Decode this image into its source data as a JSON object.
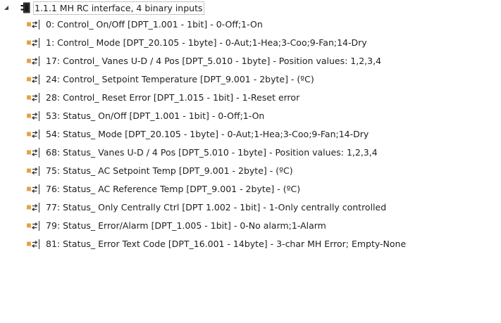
{
  "tree": {
    "device": {
      "label": "1.1.1  MH RC interface, 4 binary inputs",
      "expanded": true,
      "expander_icon": "triangle-down-icon",
      "icon": "knx-device-icon"
    },
    "object_icon": "group-object-arrows-icon",
    "objects": [
      {
        "label": "0: Control_ On/Off [DPT_1.001 - 1bit] - 0-Off;1-On"
      },
      {
        "label": "1: Control_ Mode [DPT_20.105 - 1byte] - 0-Aut;1-Hea;3-Coo;9-Fan;14-Dry"
      },
      {
        "label": "17: Control_ Vanes U-D / 4 Pos [DPT_5.010 - 1byte] - Position values: 1,2,3,4"
      },
      {
        "label": "24: Control_ Setpoint Temperature [DPT_9.001 - 2byte] - (ºC)"
      },
      {
        "label": "28: Control_ Reset Error [DPT_1.015 - 1bit] - 1-Reset error"
      },
      {
        "label": "53: Status_ On/Off [DPT_1.001 - 1bit] - 0-Off;1-On"
      },
      {
        "label": "54: Status_ Mode [DPT_20.105 - 1byte] - 0-Aut;1-Hea;3-Coo;9-Fan;14-Dry"
      },
      {
        "label": "68: Status_ Vanes U-D / 4 Pos [DPT_5.010 - 1byte] - Position values: 1,2,3,4"
      },
      {
        "label": "75: Status_ AC Setpoint Temp [DPT_9.001 - 2byte] - (ºC)"
      },
      {
        "label": "76: Status_ AC Reference Temp [DPT_9.001 - 2byte] - (ºC)"
      },
      {
        "label": "77: Status_ Only Centrally Ctrl [DPT 1.002 - 1bit] - 1-Only centrally controlled"
      },
      {
        "label": "79: Status_ Error/Alarm [DPT_1.005 - 1bit] - 0-No alarm;1-Alarm"
      },
      {
        "label": "81: Status_ Error Text Code [DPT_16.001 - 14byte] - 3-char MH Error; Empty-None"
      }
    ],
    "colors": {
      "device_icon_fill": "#1b1b1b",
      "object_block": "#e8a33d",
      "object_arrows": "#3a3a3a",
      "text": "#1e1e1e"
    }
  }
}
